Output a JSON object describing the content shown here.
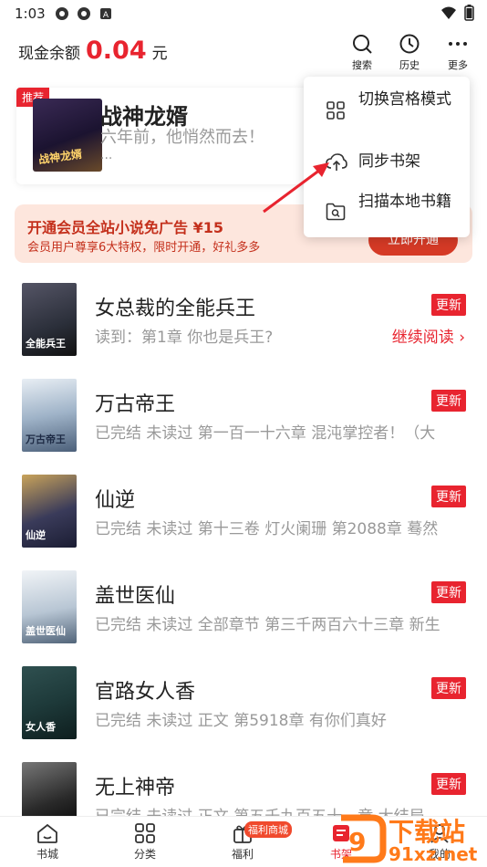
{
  "status_bar": {
    "time": "1:03"
  },
  "header": {
    "balance_label": "现金余额",
    "balance_amount": "0.04",
    "balance_unit": "元",
    "search_label": "搜索",
    "history_label": "历史",
    "more_label": "更多"
  },
  "featured": {
    "tag": "推荐",
    "cover_title": "战神龙婿",
    "title": "战神龙婿",
    "desc": "六年前，他悄然而去！",
    "more": "..."
  },
  "vip_banner": {
    "title": "开通会员全站小说免广告 ¥15",
    "subtitle": "会员用户尊享6大特权，限时开通，好礼多多",
    "button": "立即开通"
  },
  "menu": {
    "items": [
      {
        "label": "切换宫格模式",
        "icon": "grid-icon"
      },
      {
        "label": "同步书架",
        "icon": "cloud-sync-icon"
      },
      {
        "label": "扫描本地书籍",
        "icon": "folder-search-icon"
      }
    ]
  },
  "books": [
    {
      "title": "女总裁的全能兵王",
      "sub": "读到：第1章 你也是兵王?",
      "badge": "更新",
      "continue": "继续阅读 ›",
      "cover_text": "全能兵王",
      "cover_color": "#2b2f3a"
    },
    {
      "title": "万古帝王",
      "sub": "已完结 未读过 第一百一十六章 混沌掌控者！（大",
      "badge": "更新",
      "cover_text": "万古帝王",
      "cover_color": "#6f8aa8"
    },
    {
      "title": "仙逆",
      "sub": "已完结 未读过 第十三卷 灯火阑珊 第2088章 蓦然",
      "badge": "更新",
      "cover_text": "仙逆",
      "cover_color": "#3a3b5a"
    },
    {
      "title": "盖世医仙",
      "sub": "已完结 未读过 全部章节 第三千两百六十三章 新生",
      "badge": "更新",
      "cover_text": "盖世医仙",
      "cover_color": "#8aa0b5"
    },
    {
      "title": "官路女人香",
      "sub": "已完结 未读过 正文 第5918章 有你们真好",
      "badge": "更新",
      "cover_text": "女人香",
      "cover_color": "#1e3a3a"
    },
    {
      "title": "无上神帝",
      "sub": "已完结 未读过 正文 第五千九百五十一章 大结局",
      "badge": "更新",
      "cover_text": "无上",
      "cover_color": "#2a2a2a"
    }
  ],
  "tabbar": {
    "tabs": [
      {
        "label": "书城",
        "icon": "home-icon"
      },
      {
        "label": "分类",
        "icon": "category-icon"
      },
      {
        "label": "福利",
        "icon": "gift-icon"
      },
      {
        "label": "书架",
        "icon": "bookshelf-icon"
      },
      {
        "label": "我的",
        "icon": "profile-icon"
      }
    ],
    "welfare_badge": "福利商城"
  },
  "watermark": {
    "text1": "下载站",
    "text2": "91xz.net"
  }
}
